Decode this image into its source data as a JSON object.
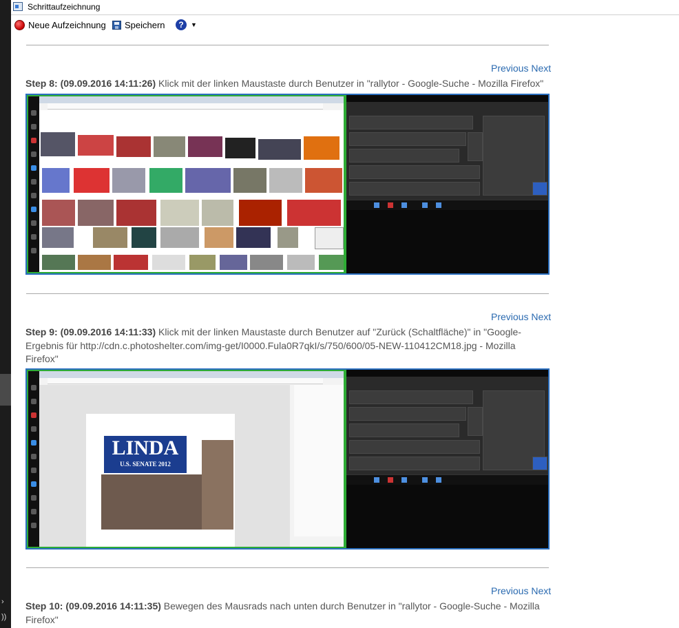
{
  "window": {
    "title": "Schrittaufzeichnung"
  },
  "toolbar": {
    "record_label": "Neue Aufzeichnung",
    "save_label": "Speichern",
    "help_glyph": "?",
    "dropdown_glyph": "▼"
  },
  "nav": {
    "previous": "Previous",
    "next": "Next"
  },
  "steps": [
    {
      "heading": "Step 8: (09.09.2016 14:11:26)",
      "text": " Klick mit der linken Maustaste durch Benutzer in \"rallytor - Google-Suche - Mozilla Firefox\""
    },
    {
      "heading": "Step 9: (09.09.2016 14:11:33)",
      "text": " Klick mit der linken Maustaste durch Benutzer auf \"Zurück (Schaltfläche)\" in \"Google-Ergebnis für http://cdn.c.photoshelter.com/img-get/I0000.Fula0R7qkI/s/750/600/05-NEW-110412CM18.jpg - Mozilla Firefox\""
    },
    {
      "heading": "Step 10: (09.09.2016 14:11:35)",
      "text": " Bewegen des Mausrads nach unten durch Benutzer in \"rallytor - Google-Suche - Mozilla Firefox\""
    }
  ],
  "screenshot_content": {
    "linda_sign_main": "LINDA",
    "linda_sign_sub": "U.S. SENATE 2012"
  },
  "colors": {
    "link": "#2a6ab0",
    "screenshot_border": "#2a6fc0",
    "monitor_border": "#2eac35",
    "record": "#c80000"
  },
  "icons": [
    "record-icon",
    "save-icon",
    "help-icon",
    "chevron-down-icon"
  ]
}
